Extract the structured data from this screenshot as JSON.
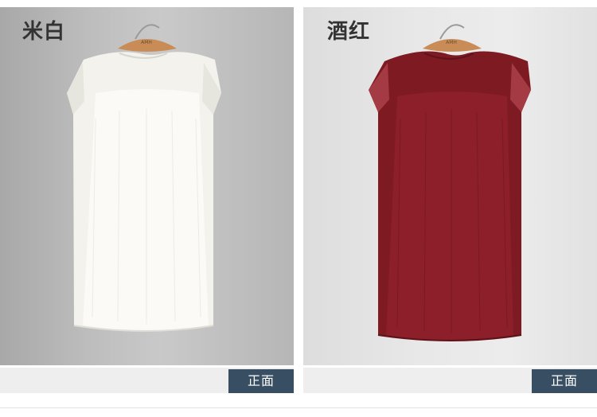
{
  "products": [
    {
      "color_name": "米白",
      "view_label": "正面",
      "dress_color": "#f4f3ee",
      "hanger_brand": "AMH"
    },
    {
      "color_name": "酒红",
      "view_label": "正面",
      "dress_color": "#8a1e26",
      "hanger_brand": "AMH"
    }
  ]
}
